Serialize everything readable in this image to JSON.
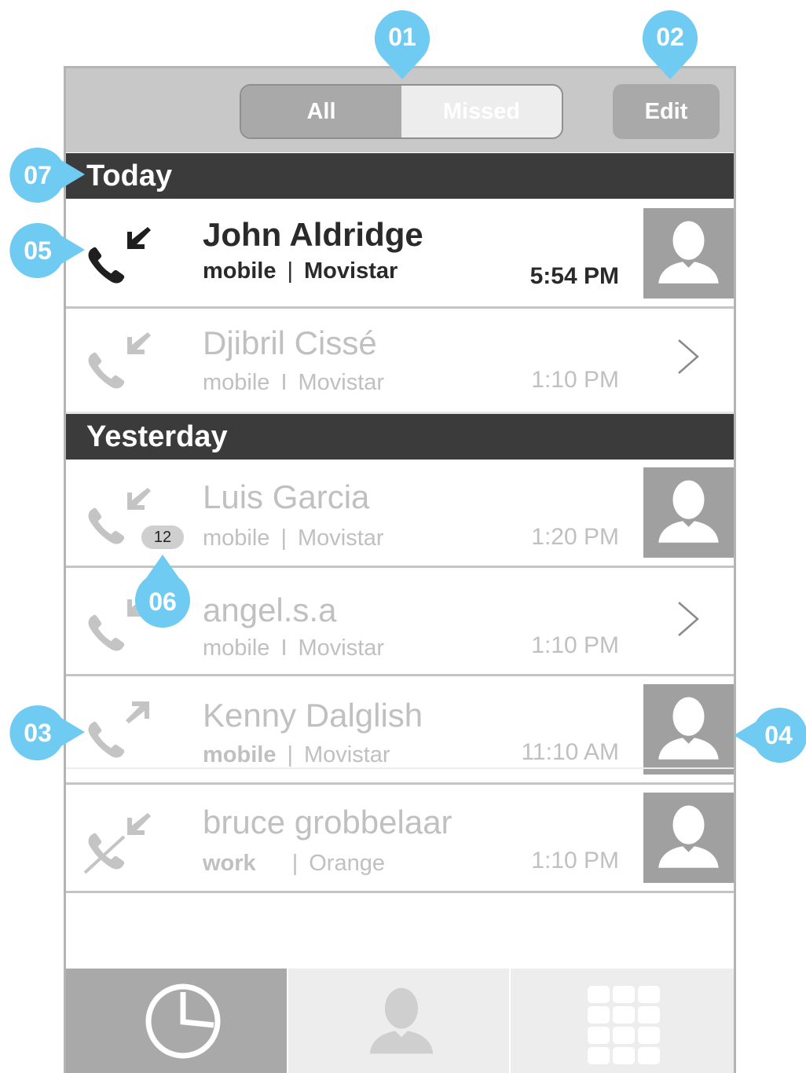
{
  "header": {
    "segment_all": "All",
    "segment_missed": "Missed",
    "edit": "Edit"
  },
  "sections": {
    "today": "Today",
    "yesterday": "Yesterday"
  },
  "calls": [
    {
      "name": "John Aldridge",
      "type": "mobile",
      "separator": "|",
      "carrier": "Movistar",
      "time": "5:54 PM"
    },
    {
      "name": "Djibril Cissé",
      "type": "mobile",
      "separator": "I",
      "carrier": "Movistar",
      "time": "1:10 PM"
    },
    {
      "name": "Luis Garcia",
      "type": "mobile",
      "separator": "|",
      "carrier": "Movistar",
      "time": "1:20 PM",
      "badge": "12"
    },
    {
      "name": "angel.s.a",
      "type": "mobile",
      "separator": "I",
      "carrier": "Movistar",
      "time": "1:10 PM"
    },
    {
      "name": "Kenny Dalglish",
      "type": "mobile",
      "separator": "|",
      "carrier": "Movistar",
      "time": "11:10 AM"
    },
    {
      "name": "bruce grobbelaar",
      "type": "work",
      "separator": "|",
      "carrier": "Orange",
      "time": "1:10 PM"
    }
  ],
  "callouts": [
    "01",
    "02",
    "03",
    "04",
    "05",
    "06",
    "07"
  ],
  "icons": {
    "incoming": "arrow-incoming-icon",
    "outgoing": "arrow-outgoing-icon",
    "phone": "phone-icon",
    "missed": "phone-missed-icon",
    "avatar": "person-icon",
    "chevron": "chevron-right-icon",
    "recents": "clock-icon",
    "contacts": "person-icon",
    "keypad": "keypad-icon"
  },
  "colors": {
    "callout": "#6fcbf2",
    "section_bar": "#3b3b3b",
    "top_bar": "#c8c8c8",
    "avatar_bg": "#a0a0a0"
  }
}
